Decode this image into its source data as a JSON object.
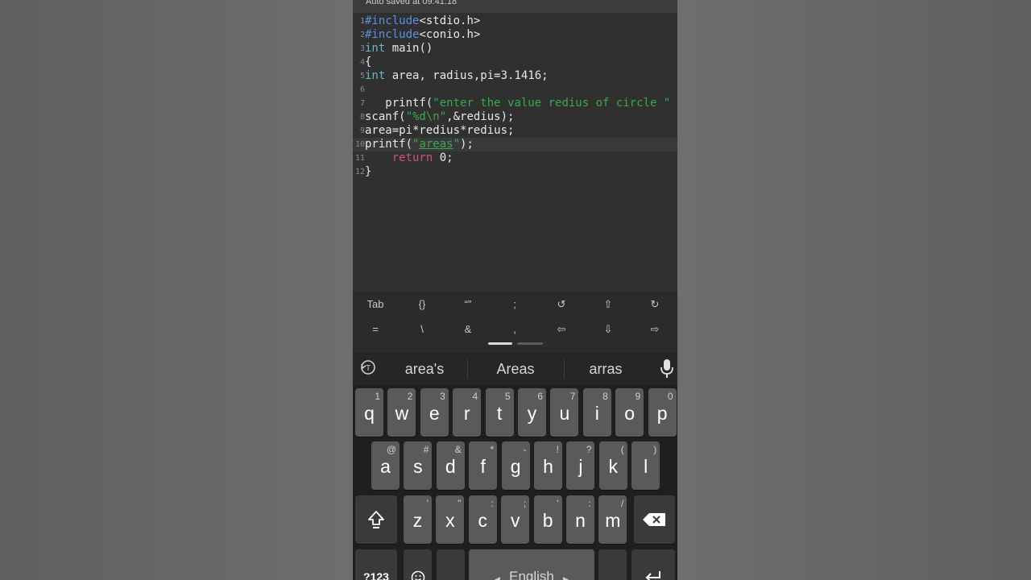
{
  "status": {
    "autosave_text": "Auto saved at 09:41:18"
  },
  "editor": {
    "lines": [
      {
        "num": "1",
        "segments": [
          {
            "text": "#include",
            "cls": "kw-pp"
          },
          {
            "text": "<stdio.h>",
            "cls": ""
          }
        ]
      },
      {
        "num": "2",
        "segments": [
          {
            "text": "#include",
            "cls": "kw-pp"
          },
          {
            "text": "<conio.h>",
            "cls": ""
          }
        ]
      },
      {
        "num": "3",
        "segments": [
          {
            "text": "int",
            "cls": "kw"
          },
          {
            "text": " main()",
            "cls": ""
          }
        ]
      },
      {
        "num": "4",
        "segments": [
          {
            "text": "{",
            "cls": ""
          }
        ]
      },
      {
        "num": "5",
        "segments": [
          {
            "text": "int",
            "cls": "kw"
          },
          {
            "text": " area, radius,pi=3.1416;",
            "cls": ""
          }
        ]
      },
      {
        "num": "6",
        "segments": []
      },
      {
        "num": "7",
        "segments": [
          {
            "text": "   printf(",
            "cls": ""
          },
          {
            "text": "\"enter the value redius of circle \"",
            "cls": "str"
          }
        ]
      },
      {
        "num": "8",
        "segments": [
          {
            "text": "scanf(",
            "cls": ""
          },
          {
            "text": "\"%d\\n\"",
            "cls": "str"
          },
          {
            "text": ",&redius);",
            "cls": ""
          }
        ]
      },
      {
        "num": "9",
        "segments": [
          {
            "text": "area=pi*redius*redius;",
            "cls": ""
          }
        ]
      },
      {
        "num": "10",
        "current": true,
        "segments": [
          {
            "text": "printf(",
            "cls": ""
          },
          {
            "text": "\"",
            "cls": "str"
          },
          {
            "text": "areas",
            "cls": "str ul"
          },
          {
            "text": "\"",
            "cls": "str"
          },
          {
            "text": ");",
            "cls": ""
          }
        ]
      },
      {
        "num": "11",
        "segments": [
          {
            "text": "    ",
            "cls": ""
          },
          {
            "text": "return",
            "cls": "ret"
          },
          {
            "text": " 0;",
            "cls": ""
          }
        ]
      },
      {
        "num": "12",
        "segments": [
          {
            "text": "}",
            "cls": ""
          }
        ]
      }
    ]
  },
  "extra_keys": {
    "row1": [
      {
        "label": "Tab",
        "name": "tab-key"
      },
      {
        "label": "{}",
        "name": "braces-key"
      },
      {
        "label": "“”",
        "name": "quotes-key"
      },
      {
        "label": ";",
        "name": "semicolon-key"
      },
      {
        "label": "↺",
        "name": "undo-key"
      },
      {
        "label": "⇧",
        "name": "arrow-up-key"
      },
      {
        "label": "↻",
        "name": "redo-key"
      }
    ],
    "row2": [
      {
        "label": "=",
        "name": "equals-key"
      },
      {
        "label": "\\",
        "name": "backslash-key"
      },
      {
        "label": "&",
        "name": "ampersand-key"
      },
      {
        "label": ",",
        "name": "comma-extra-key"
      },
      {
        "label": "⇦",
        "name": "arrow-left-key"
      },
      {
        "label": "⇩",
        "name": "arrow-down-key"
      },
      {
        "label": "⇨",
        "name": "arrow-right-key"
      }
    ]
  },
  "suggestions": {
    "left": "area's",
    "center": "Areas",
    "right": "arras"
  },
  "keyboard": {
    "row1": [
      {
        "k": "q",
        "h": "1"
      },
      {
        "k": "w",
        "h": "2"
      },
      {
        "k": "e",
        "h": "3"
      },
      {
        "k": "r",
        "h": "4"
      },
      {
        "k": "t",
        "h": "5"
      },
      {
        "k": "y",
        "h": "6"
      },
      {
        "k": "u",
        "h": "7"
      },
      {
        "k": "i",
        "h": "8"
      },
      {
        "k": "o",
        "h": "9"
      },
      {
        "k": "p",
        "h": "0"
      }
    ],
    "row2": [
      {
        "k": "a",
        "h": "@"
      },
      {
        "k": "s",
        "h": "#"
      },
      {
        "k": "d",
        "h": "&"
      },
      {
        "k": "f",
        "h": "*"
      },
      {
        "k": "g",
        "h": "-"
      },
      {
        "k": "h",
        "h": "!"
      },
      {
        "k": "j",
        "h": "?"
      },
      {
        "k": "k",
        "h": "("
      },
      {
        "k": "l",
        "h": ")"
      }
    ],
    "row3": [
      {
        "k": "z",
        "h": "'"
      },
      {
        "k": "x",
        "h": "\""
      },
      {
        "k": "c",
        "h": ":"
      },
      {
        "k": "v",
        "h": ";"
      },
      {
        "k": "b",
        "h": "'"
      },
      {
        "k": "n",
        "h": ":"
      },
      {
        "k": "m",
        "h": "/"
      }
    ],
    "symbols_label": "?123",
    "space_label": "English",
    "accent_color": "#ffffff"
  }
}
